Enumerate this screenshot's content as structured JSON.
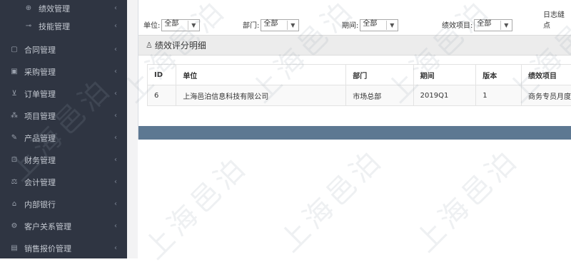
{
  "sidebar": {
    "items": [
      {
        "label": "绩效管理",
        "icon": "target-icon",
        "sub": true
      },
      {
        "label": "技能管理",
        "icon": "wrench-icon",
        "sub": true
      },
      {
        "label": "合同管理",
        "icon": "document-icon",
        "sub": false
      },
      {
        "label": "采购管理",
        "icon": "cart-box-icon",
        "sub": false
      },
      {
        "label": "订单管理",
        "icon": "cart-icon",
        "sub": false
      },
      {
        "label": "项目管理",
        "icon": "sitemap-icon",
        "sub": false
      },
      {
        "label": "产品管理",
        "icon": "edit-icon",
        "sub": false
      },
      {
        "label": "财务管理",
        "icon": "money-icon",
        "sub": false
      },
      {
        "label": "会计管理",
        "icon": "scale-icon",
        "sub": false
      },
      {
        "label": "内部银行",
        "icon": "bank-icon",
        "sub": false
      },
      {
        "label": "客户关系管理",
        "icon": "gears-icon",
        "sub": false
      },
      {
        "label": "销售报价管理",
        "icon": "chart-icon",
        "sub": false
      }
    ],
    "chevron": "‹"
  },
  "filters": {
    "unit": {
      "label": "单位:",
      "value": "全部"
    },
    "dept": {
      "label": "部门:",
      "value": "全部"
    },
    "period": {
      "label": "期间:",
      "value": "全部"
    },
    "item": {
      "label": "绩效项目:",
      "value": "全部"
    },
    "log": {
      "label": "日志缝点"
    }
  },
  "section": {
    "title": "绩效评分明细"
  },
  "table": {
    "headers": [
      "ID",
      "单位",
      "部门",
      "期间",
      "版本",
      "绩效项目"
    ],
    "rows": [
      [
        "6",
        "上海邑泊信息科技有限公司",
        "市场总部",
        "2019Q1",
        "1",
        "商务专员月度"
      ]
    ]
  },
  "watermark": "上海邑泊"
}
